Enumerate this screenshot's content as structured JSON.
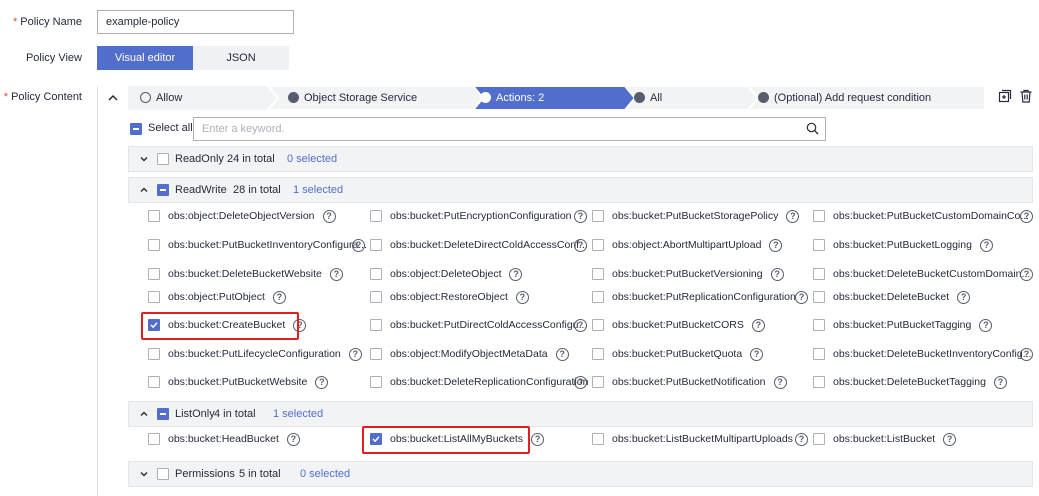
{
  "form": {
    "policy_name_label": "Policy Name",
    "policy_name_value": "example-policy",
    "policy_view_label": "Policy View",
    "policy_content_label": "Policy Content",
    "required_mark": "*"
  },
  "view_tabs": {
    "visual": "Visual editor",
    "json": "JSON"
  },
  "steps": {
    "effect": "Allow",
    "service": "Object Storage Service",
    "actions": "Actions: 2",
    "resources": "All",
    "condition": "(Optional) Add request condition"
  },
  "search": {
    "select_all": "Select all",
    "placeholder": "Enter a keyword."
  },
  "groups": {
    "readonly": {
      "name": "ReadOnly",
      "total": "24 in total",
      "selected": "0 selected"
    },
    "readwrite": {
      "name": "ReadWrite",
      "total": "28 in total",
      "selected": "1 selected"
    },
    "listonly": {
      "name": "ListOnly",
      "total": "4 in total",
      "selected": "1 selected"
    },
    "permissions": {
      "name": "Permissions",
      "total": "5 in total",
      "selected": "0 selected"
    }
  },
  "readwrite_items": [
    "obs:object:DeleteObjectVersion",
    "obs:bucket:PutEncryptionConfiguration",
    "obs:bucket:PutBucketStoragePolicy",
    "obs:bucket:PutBucketCustomDomainCo...",
    "obs:bucket:PutBucketInventoryConfigura...",
    "obs:bucket:DeleteDirectColdAccessConf...",
    "obs:object:AbortMultipartUpload",
    "obs:bucket:PutBucketLogging",
    "obs:bucket:DeleteBucketWebsite",
    "obs:object:DeleteObject",
    "obs:bucket:PutBucketVersioning",
    "obs:bucket:DeleteBucketCustomDomain...",
    "obs:object:PutObject",
    "obs:object:RestoreObject",
    "obs:bucket:PutReplicationConfiguration",
    "obs:bucket:DeleteBucket",
    "obs:bucket:CreateBucket",
    "obs:bucket:PutDirectColdAccessConfigu...",
    "obs:bucket:PutBucketCORS",
    "obs:bucket:PutBucketTagging",
    "obs:bucket:PutLifecycleConfiguration",
    "obs:object:ModifyObjectMetaData",
    "obs:bucket:PutBucketQuota",
    "obs:bucket:DeleteBucketInventoryConfig...",
    "obs:bucket:PutBucketWebsite",
    "obs:bucket:DeleteReplicationConfiguration",
    "obs:bucket:PutBucketNotification",
    "obs:bucket:DeleteBucketTagging"
  ],
  "listonly_items": [
    "obs:bucket:HeadBucket",
    "obs:bucket:ListAllMyBuckets",
    "obs:bucket:ListBucketMultipartUploads",
    "obs:bucket:ListBucket"
  ],
  "help_glyph": "?",
  "colors": {
    "accent": "#526ecc",
    "highlight": "#e02020",
    "required": "#e54545"
  }
}
